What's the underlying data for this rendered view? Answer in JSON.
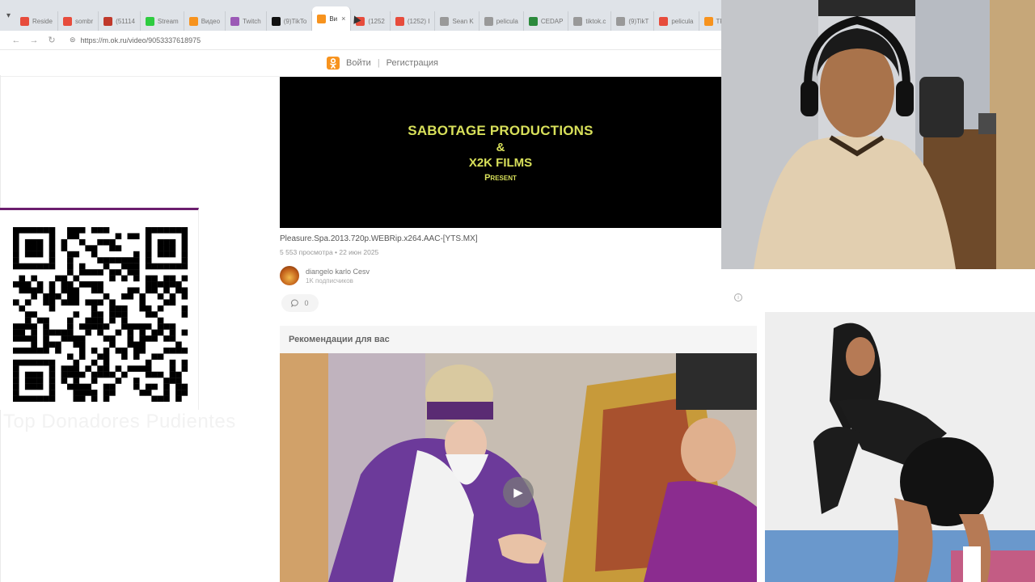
{
  "browser": {
    "tabs": [
      {
        "label": "Reside",
        "color": "#e74c3c"
      },
      {
        "label": "sombr",
        "color": "#e74c3c"
      },
      {
        "label": "(51114",
        "color": "#c0392b"
      },
      {
        "label": "Stream",
        "color": "#2ecc40"
      },
      {
        "label": "Видео",
        "color": "#f7931e"
      },
      {
        "label": "Twitch",
        "color": "#9b59b6"
      },
      {
        "label": "(9)TikTo",
        "color": "#111111"
      },
      {
        "label": "Ви",
        "color": "#f7931e",
        "active": true
      },
      {
        "label": "(1252",
        "color": "#e74c3c"
      },
      {
        "label": "(1252) I",
        "color": "#e74c3c"
      },
      {
        "label": "Sean K",
        "color": "#999999"
      },
      {
        "label": "pelicula",
        "color": "#999999"
      },
      {
        "label": "CEDAP",
        "color": "#2c8a3c"
      },
      {
        "label": "tiktok.c",
        "color": "#999999"
      },
      {
        "label": "(9)TikT",
        "color": "#999999"
      },
      {
        "label": "pelicula",
        "color": "#e74c3c"
      },
      {
        "label": "TRAUM",
        "color": "#f7931e"
      }
    ],
    "url": "https://m.ok.ru/video/9053337618975",
    "close_glyph": "×"
  },
  "ok_header": {
    "logo": "ok",
    "login": "Войти",
    "separator": "|",
    "register": "Регистрация"
  },
  "video": {
    "line1": "SABOTAGE PRODUCTIONS",
    "line2": "&",
    "line3": "X2K FILMS",
    "line4": "Present",
    "title": "Pleasure.Spa.2013.720p.WEBRip.x264.AAC-[YTS.MX]",
    "meta": "5 553 просмотра • 22 июн 2025",
    "channel_name": "diangelo karlo Cesv",
    "channel_subs": "1K подписчиков",
    "comments_count": "0"
  },
  "recommendations": {
    "title": "Рекомендации для вас"
  },
  "overlay": {
    "donors_text": "Top Donadores Pudientes",
    "donors_sub": "................................"
  },
  "colors": {
    "ok_orange": "#f7931e",
    "video_text": "#d8e05a",
    "qr_border": "#6b1e6e"
  }
}
